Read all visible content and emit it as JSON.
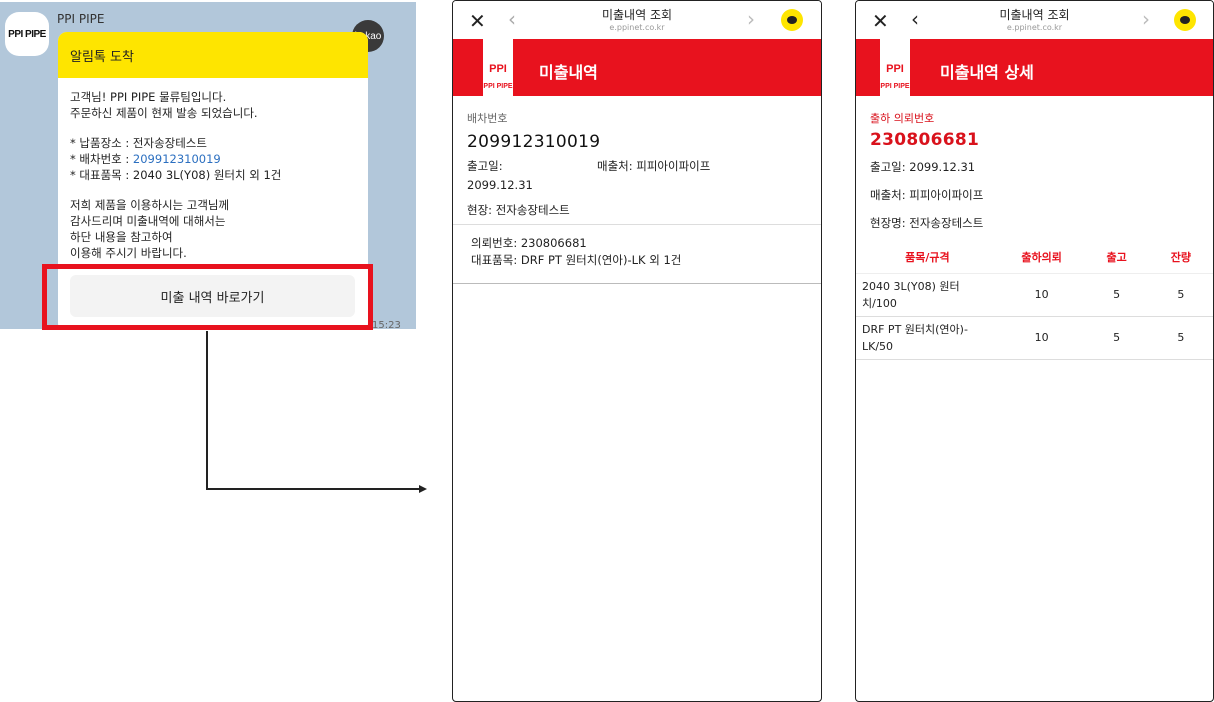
{
  "chat": {
    "avatar_text": "PPI PIPE",
    "sender": "PPI PIPE",
    "kakao_badge": "kakao",
    "title": "알림톡 도착",
    "line1": "고객님! PPI PIPE 물류팀입니다.",
    "line2": "주문하신 제품이 현재 발송 되었습니다.",
    "field_place": "* 납품장소 : 전자송장테스트",
    "field_dispatch_label": "* 배차번호 : ",
    "field_dispatch_value": "209912310019",
    "field_item": "* 대표품목 : 2040 3L(Y08) 원터치 외 1건",
    "closing1": "저희 제품을 이용하시는 고객님께",
    "closing2": "감사드리며 미출내역에 대해서는",
    "closing3": "하단 내용을 참고하여",
    "closing4": "이용해 주시기 바랍니다.",
    "button": "미출 내역 바로가기",
    "time": "15:23"
  },
  "screen1": {
    "topbar_title": "미출내역 조회",
    "topbar_url": "e.ppinet.co.kr",
    "logo_top": "PPI",
    "logo_bottom": "PPI PIPE",
    "header_title": "미출내역",
    "dispatch_label": "배차번호",
    "dispatch_value": "209912310019",
    "out_date_label": "출고일:",
    "out_date_value": "2099.12.31",
    "seller": "매출처: 피피아이파이프",
    "site": "현장: 전자송장테스트",
    "card_request": "의뢰번호: 230806681",
    "card_item": "대표품목: DRF PT 원터치(연아)-LK 외 1건"
  },
  "screen2": {
    "topbar_title": "미출내역 조회",
    "topbar_url": "e.ppinet.co.kr",
    "logo_top": "PPI",
    "logo_bottom": "PPI PIPE",
    "header_title": "미출내역 상세",
    "request_label": "출하 의뢰번호",
    "request_value": "230806681",
    "out_date": "출고일: 2099.12.31",
    "seller": "매출처: 피피아이파이프",
    "site": "현장명: 전자송장테스트",
    "columns": [
      "품목/규격",
      "출하의뢰",
      "출고",
      "잔량"
    ],
    "rows": [
      {
        "item_line1": "2040 3L(Y08) 원터",
        "item_line2": "치/100",
        "request": "10",
        "out": "5",
        "remain": "5"
      },
      {
        "item_line1": "DRF PT 원터치(연아)-",
        "item_line2": "LK/50",
        "request": "10",
        "out": "5",
        "remain": "5"
      }
    ]
  },
  "colors": {
    "kakao_yellow": "#fee500",
    "brand_red": "#e8121e",
    "chat_bg": "#b2c7da",
    "link_blue": "#2b6fc0"
  }
}
